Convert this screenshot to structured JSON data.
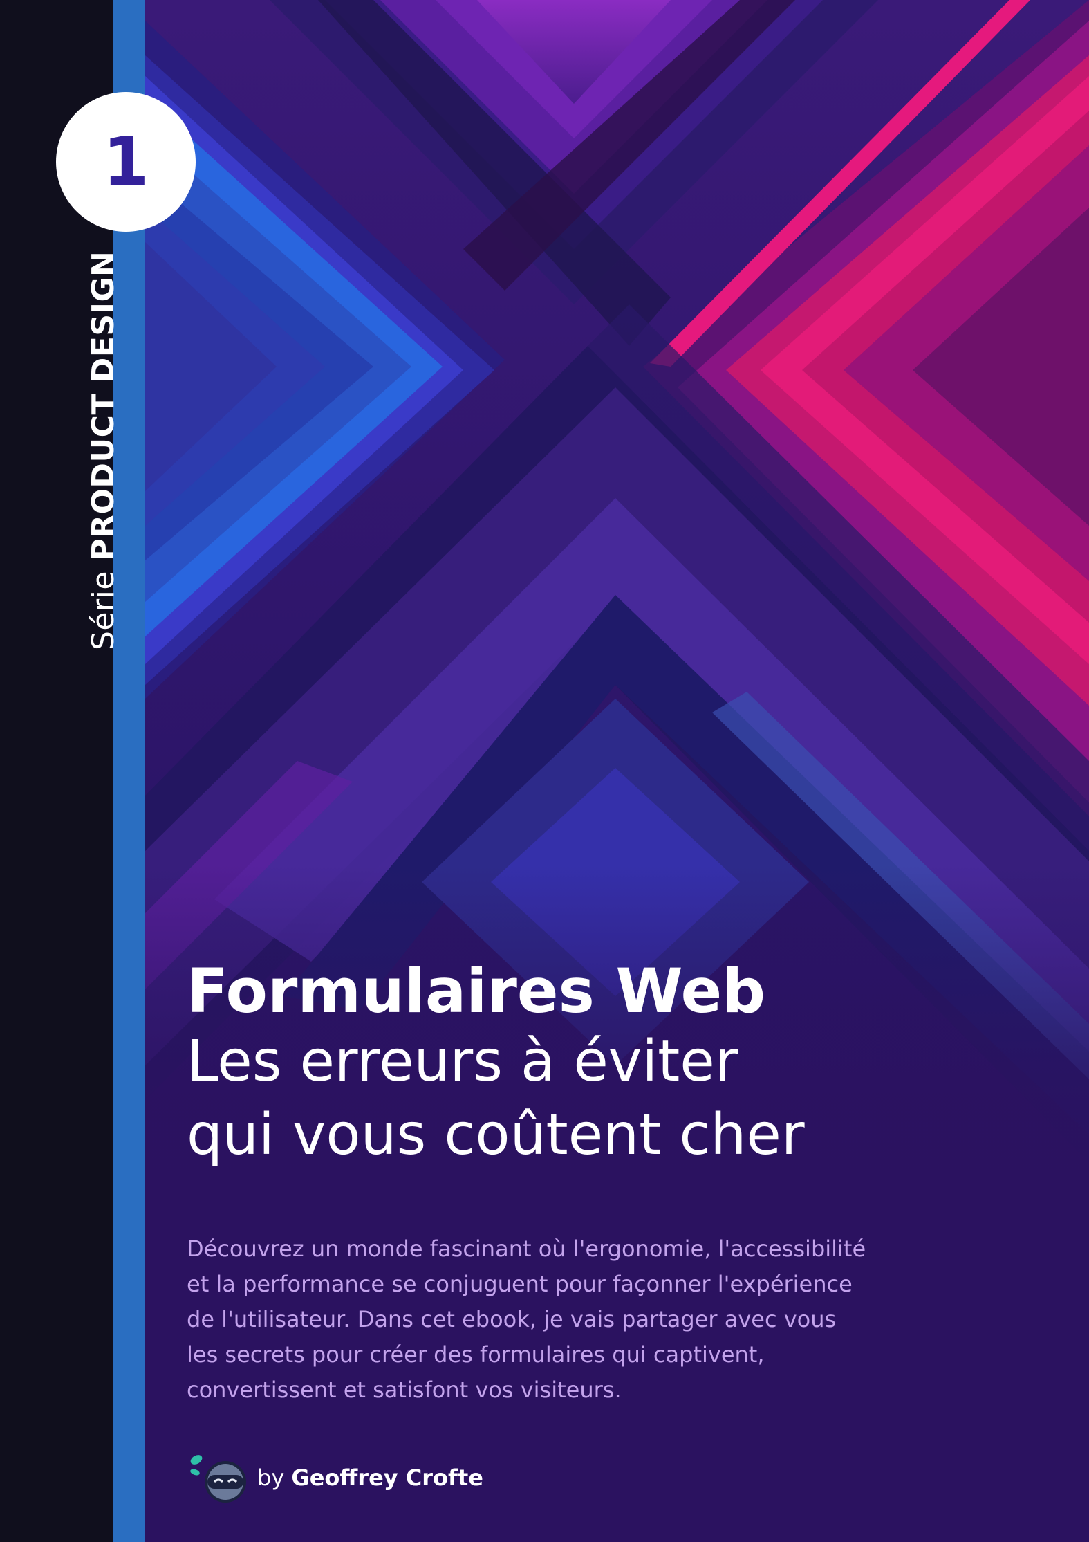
{
  "cover": {
    "volume_number": "1",
    "series_prefix": "Série",
    "series_name": "PRODUCT DESIGN",
    "title": "Formulaires Web",
    "subtitle_line1": "Les erreurs à éviter",
    "subtitle_line2": "qui vous coûtent cher",
    "intro_lines": [
      "Découvrez un monde fascinant où l'ergonomie, l'accessibilité",
      "et la performance se conjuguent pour façonner l'expérience",
      "de l'utilisateur. Dans cet ebook, je vais partager avec vous",
      "les secrets pour créer des formulaires qui captivent,",
      "convertissent et satisfont vos visiteurs."
    ],
    "author_prefix": "by",
    "author_name": "Geoffrey Crofte",
    "author_icon": "ninja-avatar-icon"
  },
  "colors": {
    "spine": "#100f1d",
    "spine_stripe": "#2a6ec1",
    "badge_number": "#33219a",
    "intro_text": "#c3a3ec",
    "background": "#2a1660",
    "accent_pink": "#e31b78",
    "accent_blue": "#2765d8"
  }
}
